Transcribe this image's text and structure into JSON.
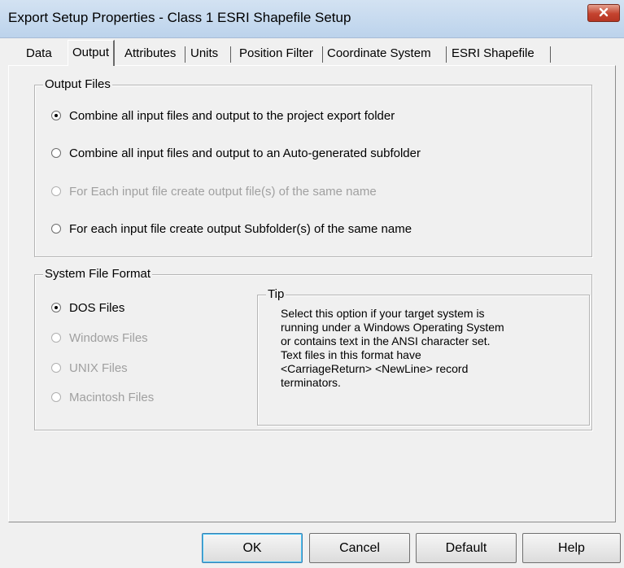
{
  "window": {
    "title": "Export Setup Properties - Class 1 ESRI Shapefile Setup"
  },
  "tabs": [
    {
      "label": "Data"
    },
    {
      "label": "Output"
    },
    {
      "label": "Attributes"
    },
    {
      "label": "Units"
    },
    {
      "label": "Position Filter"
    },
    {
      "label": "Coordinate System"
    },
    {
      "label": "ESRI Shapefile"
    }
  ],
  "output_files": {
    "title": "Output Files",
    "options": [
      {
        "label": "Combine all input files and output to the project export folder",
        "checked": true,
        "enabled": true
      },
      {
        "label": "Combine all input files and output to an Auto-generated subfolder",
        "checked": false,
        "enabled": true
      },
      {
        "label": "For Each input file create output file(s) of the same name",
        "checked": false,
        "enabled": false
      },
      {
        "label": "For each input file create output Subfolder(s) of the same name",
        "checked": false,
        "enabled": true
      }
    ]
  },
  "system_file_format": {
    "title": "System File Format",
    "options": [
      {
        "label": "DOS Files",
        "checked": true,
        "enabled": true
      },
      {
        "label": "Windows Files",
        "checked": false,
        "enabled": false
      },
      {
        "label": "UNIX Files",
        "checked": false,
        "enabled": false
      },
      {
        "label": "Macintosh Files",
        "checked": false,
        "enabled": false
      }
    ],
    "tip": {
      "title": "Tip",
      "text": "Select this option if your target system is\nrunning under a Windows Operating System\nor contains text in the ANSI character set.\nText files in this format have\n<CarriageReturn> <NewLine> record\nterminators."
    }
  },
  "buttons": {
    "ok": "OK",
    "cancel": "Cancel",
    "default": "Default",
    "help": "Help"
  },
  "icons": {
    "close": "close-icon"
  },
  "colors": {
    "close_button": "#c4432f",
    "title_bar": "#bcd3ec",
    "dialog_bg": "#f0f0f0"
  }
}
